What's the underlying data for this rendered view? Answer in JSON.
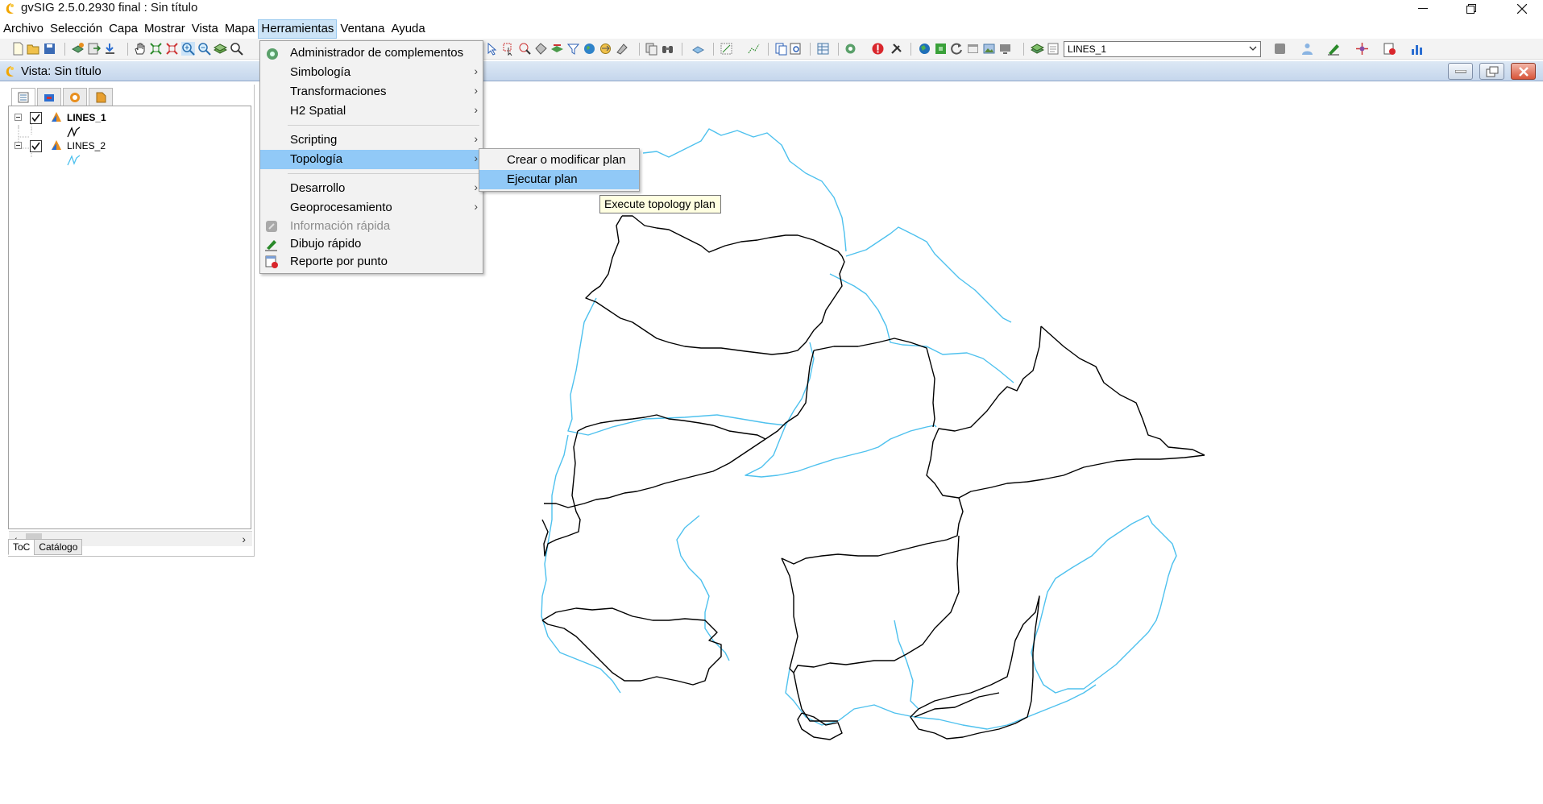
{
  "window": {
    "title": "gvSIG 2.5.0.2930 final : Sin título"
  },
  "menubar": [
    {
      "label": "Archivo"
    },
    {
      "label": "Selección"
    },
    {
      "label": "Capa"
    },
    {
      "label": "Mostrar"
    },
    {
      "label": "Vista"
    },
    {
      "label": "Mapa"
    },
    {
      "label": "Herramientas",
      "active": true
    },
    {
      "label": "Ventana"
    },
    {
      "label": "Ayuda"
    }
  ],
  "toolbar": {
    "layer_select_value": "LINES_1"
  },
  "view": {
    "title": "Vista: Sin título"
  },
  "toc": {
    "layers": [
      {
        "name": "LINES_1",
        "checked": true,
        "bold": true,
        "symbol_color": "#000000"
      },
      {
        "name": "LINES_2",
        "checked": true,
        "bold": false,
        "symbol_color": "#4ec1ee"
      }
    ],
    "bottom_tabs": [
      {
        "label": "ToC",
        "selected": true
      },
      {
        "label": "Catálogo",
        "selected": false
      }
    ]
  },
  "herramientas_menu": {
    "items": [
      {
        "label": "Administrador de complementos",
        "icon": "plugin-gear-icon",
        "submenu": false,
        "enabled": true
      },
      {
        "label": "Simbología",
        "submenu": true,
        "enabled": true
      },
      {
        "label": "Transformaciones",
        "submenu": true,
        "enabled": true
      },
      {
        "label": "H2 Spatial",
        "submenu": true,
        "enabled": true
      },
      {
        "label": "Scripting",
        "submenu": true,
        "enabled": true
      },
      {
        "label": "Topología",
        "submenu": true,
        "enabled": true,
        "highlighted": true
      },
      {
        "label": "Desarrollo",
        "submenu": true,
        "enabled": true
      },
      {
        "label": "Geoprocesamiento",
        "submenu": true,
        "enabled": true
      },
      {
        "label": "Información rápida",
        "icon": "info-icon",
        "submenu": false,
        "enabled": false
      },
      {
        "label": "Dibujo rápido",
        "icon": "pencil-icon",
        "submenu": false,
        "enabled": true
      },
      {
        "label": "Reporte por punto",
        "icon": "report-icon",
        "submenu": false,
        "enabled": true
      }
    ]
  },
  "topologia_submenu": {
    "items": [
      {
        "label": "Crear o modificar plan",
        "highlighted": false
      },
      {
        "label": "Ejecutar plan",
        "highlighted": true
      }
    ]
  },
  "tooltip": {
    "text": "Execute topology plan"
  },
  "colors": {
    "black_lines": "#000000",
    "blue_lines": "#4ec1ee",
    "menu_highlight": "#91c9f7"
  }
}
